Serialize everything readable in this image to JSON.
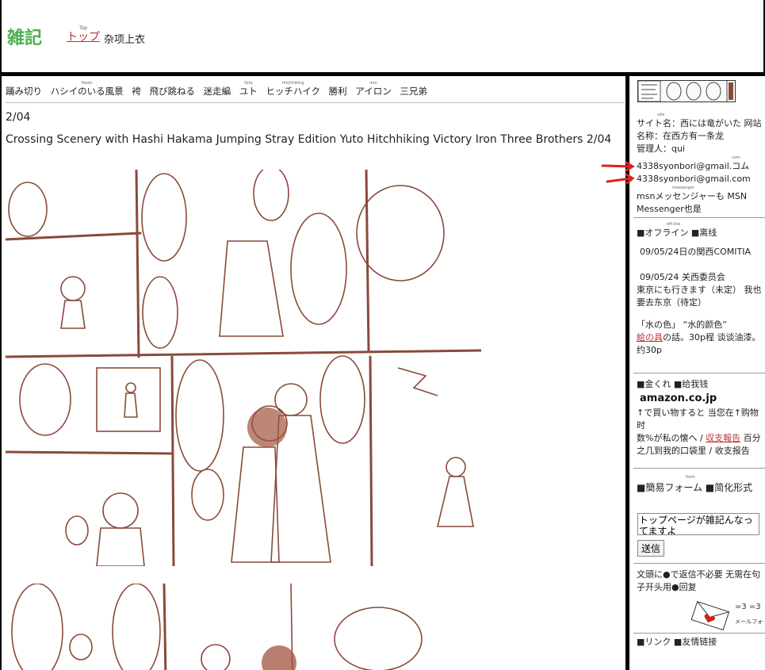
{
  "header": {
    "logo": "雑記",
    "top_ruby": "Top",
    "top_link": "トップ",
    "top_sub": "杂项上衣"
  },
  "nav": {
    "items": [
      {
        "label": "踊み切り",
        "ruby": ""
      },
      {
        "label": "ハシイのいる風景",
        "ruby": "Hashi"
      },
      {
        "label": "袴",
        "ruby": ""
      },
      {
        "label": "飛び跳ねる",
        "ruby": ""
      },
      {
        "label": "迷走編",
        "ruby": ""
      },
      {
        "label": "ユト",
        "ruby": "Yuto"
      },
      {
        "label": "ヒッチハイク",
        "ruby": "hitchhiking"
      },
      {
        "label": "勝利",
        "ruby": ""
      },
      {
        "label": "アイロン",
        "ruby": "iron"
      },
      {
        "label": "三兄弟",
        "ruby": ""
      }
    ]
  },
  "post": {
    "date": "2/04",
    "title": "Crossing Scenery with Hashi Hakama Jumping Stray Edition Yuto Hitchhiking Victory Iron Three Brothers 2/04"
  },
  "sidebar": {
    "site_ruby": "site",
    "site_name": "サイト名：西には竜がいた 网站名称：在西方有一条龙",
    "admin": "管理人：qui",
    "email_ruby": "com",
    "email_jp": "4338syonbori@gmail.コム",
    "email": "4338syonbori@gmail.com",
    "messenger_ruby": "messenger",
    "messenger": "msnメッセンジャーも MSN Messenger也是",
    "offline_ruby": "off-line",
    "offline_heading": "■オフライン ■离线",
    "event1": "09/05/24日の関西COMITIA",
    "event2": "09/05/24 关西委员会",
    "tokyo": "東京にも行きます（未定） 我也要去东京（待定）",
    "book_line1": "「水の色」 “水的颜色”",
    "book_link": "絵の具",
    "book_line2": "の話。30p程 谈谈油漆。约30p",
    "kanpa_heading": "■金くれ ■给我钱",
    "amazon": "amazon.co.jp",
    "amazon_text1": "↑で買い物すると 当您在↑购物时",
    "amazon_text2": "数%が私の懐へ / ",
    "amazon_link": "収支報告",
    "amazon_text3": " 百分之几到我的口袋里 / 收支报告",
    "form_ruby": "form",
    "form_heading": "■簡易フォーム ■简化形式",
    "form_value": "トップページが雑記んなってますよ",
    "send": "送信",
    "reply_note": "文頭に●で返信不必要 无需在句子开头用●回复",
    "mail_form": "メールフォーム",
    "links_heading": "■リンク ■友情链接"
  },
  "colors": {
    "logo": "#4caf50",
    "link_red": "#bb3333",
    "sketch_brown": "#8a4a3a",
    "arrow_red": "#e02020"
  }
}
